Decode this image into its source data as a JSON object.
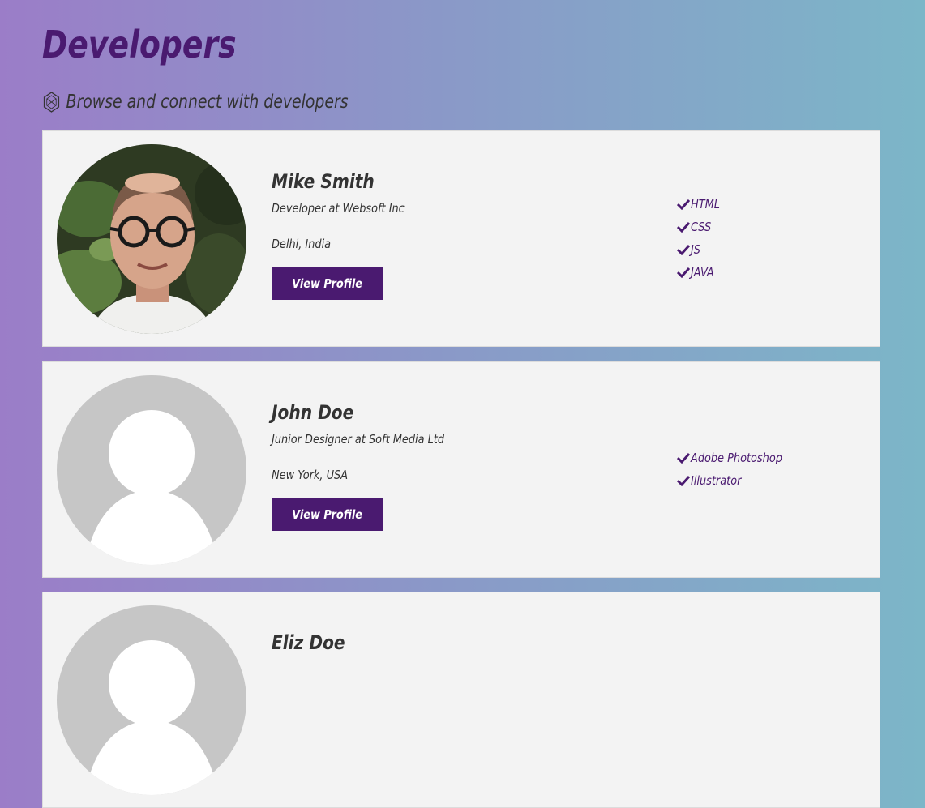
{
  "page": {
    "title": "Developers",
    "lead": "Browse and connect with developers"
  },
  "colors": {
    "primary": "#4a1a70",
    "card_bg": "#f3f3f3",
    "text": "#333333"
  },
  "icons": {
    "lead_icon": "hexagon-network-icon",
    "skill_icon": "check-icon",
    "default_avatar": "placeholder-avatar-icon"
  },
  "profiles": [
    {
      "name": "Mike Smith",
      "job": "Developer at Websoft Inc",
      "location": "Delhi, India",
      "button": "View Profile",
      "skills": [
        "HTML",
        "CSS",
        "JS",
        "JAVA"
      ]
    },
    {
      "name": "John Doe",
      "job": "Junior Designer at Soft Media Ltd",
      "location": "New York, USA",
      "button": "View Profile",
      "skills": [
        "Adobe Photoshop",
        "Illustrator"
      ]
    },
    {
      "name": "Eliz Doe"
    }
  ]
}
